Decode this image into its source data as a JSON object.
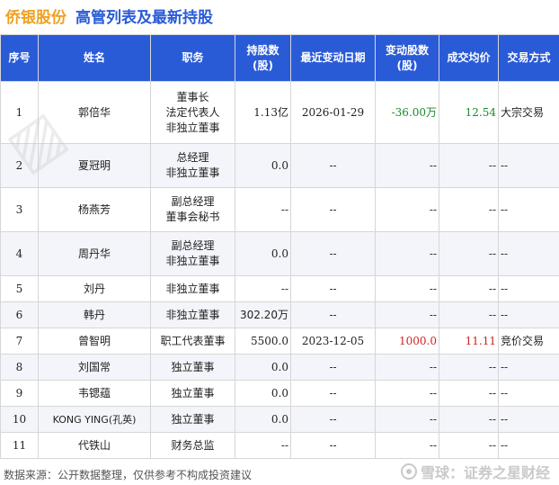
{
  "header": {
    "stock_name": "侨银股份",
    "title": "高管列表及最新持股"
  },
  "table": {
    "columns": [
      "序号",
      "姓名",
      "职务",
      "持股数(股)",
      "最近变动日期",
      "变动股数(股)",
      "成交均价",
      "交易方式"
    ],
    "col_shares_line1": "持股数",
    "col_shares_line2": "(股)",
    "col_change_line1": "变动股数",
    "col_change_line2": "(股)",
    "rows": [
      {
        "no": "1",
        "name": "郭倍华",
        "title": [
          "董事长",
          "法定代表人",
          "非独立董事"
        ],
        "shares": "1.13亿",
        "date": "2026-01-29",
        "change": "-36.00万",
        "avg_price": "12.54",
        "method": "大宗交易"
      },
      {
        "no": "2",
        "name": "夏冠明",
        "title": [
          "总经理",
          "非独立董事"
        ],
        "shares": "0.0",
        "date": "--",
        "change": "--",
        "avg_price": "--",
        "method": "--"
      },
      {
        "no": "3",
        "name": "杨燕芳",
        "title": [
          "副总经理",
          "董事会秘书"
        ],
        "shares": "--",
        "date": "--",
        "change": "--",
        "avg_price": "--",
        "method": "--"
      },
      {
        "no": "4",
        "name": "周丹华",
        "title": [
          "副总经理",
          "非独立董事"
        ],
        "shares": "0.0",
        "date": "--",
        "change": "--",
        "avg_price": "--",
        "method": "--"
      },
      {
        "no": "5",
        "name": "刘丹",
        "title": [
          "非独立董事"
        ],
        "shares": "--",
        "date": "--",
        "change": "--",
        "avg_price": "--",
        "method": "--"
      },
      {
        "no": "6",
        "name": "韩丹",
        "title": [
          "非独立董事"
        ],
        "shares": "302.20万",
        "date": "--",
        "change": "--",
        "avg_price": "--",
        "method": "--"
      },
      {
        "no": "7",
        "name": "曾智明",
        "title": [
          "职工代表董事"
        ],
        "shares": "5500.0",
        "date": "2023-12-05",
        "change": "1000.0",
        "avg_price": "11.11",
        "method": "竞价交易"
      },
      {
        "no": "8",
        "name": "刘国常",
        "title": [
          "独立董事"
        ],
        "shares": "0.0",
        "date": "--",
        "change": "--",
        "avg_price": "--",
        "method": "--"
      },
      {
        "no": "9",
        "name": "韦锶蕴",
        "title": [
          "独立董事"
        ],
        "shares": "0.0",
        "date": "--",
        "change": "--",
        "avg_price": "--",
        "method": "--"
      },
      {
        "no": "10",
        "name": "KONG YING(孔英)",
        "title": [
          "独立董事"
        ],
        "shares": "0.0",
        "date": "--",
        "change": "--",
        "avg_price": "--",
        "method": "--"
      },
      {
        "no": "11",
        "name": "代铁山",
        "title": [
          "财务总监"
        ],
        "shares": "--",
        "date": "--",
        "change": "--",
        "avg_price": "--",
        "method": "--"
      }
    ]
  },
  "footer": {
    "source": "数据来源：公开数据整理，仅供参考不构成投资建议",
    "brand": "雪球：证券之星财经"
  },
  "colors": {
    "header_bg": "#2a5bd7",
    "stock_name": "#f0a020",
    "negative": "#1a8a2c",
    "positive": "#d42020"
  }
}
